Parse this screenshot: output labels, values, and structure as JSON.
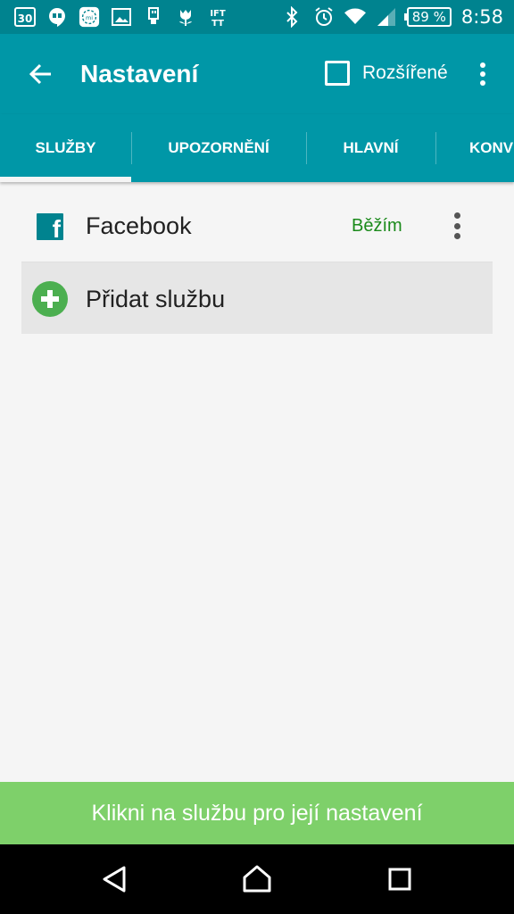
{
  "status_bar": {
    "notification_icons": [
      "calendar-30-icon",
      "hangouts-icon",
      "mi-fit-icon",
      "image-icon",
      "usb-icon",
      "tulip-icon",
      "ifttt-icon"
    ],
    "calendar_day": "30",
    "battery_level": "89 %",
    "time": "8:58"
  },
  "toolbar": {
    "title": "Nastavení",
    "extended_label": "Rozšířené",
    "extended_checked": false
  },
  "tabs": [
    {
      "label": "SLUŽBY",
      "selected": true
    },
    {
      "label": "UPOZORNĚNÍ",
      "selected": false
    },
    {
      "label": "HLAVNÍ",
      "selected": false
    },
    {
      "label": "KONV",
      "selected": false
    }
  ],
  "services": {
    "items": [
      {
        "name": "Facebook",
        "status": "Běžím",
        "icon": "facebook-icon"
      }
    ],
    "add_label": "Přidat službu"
  },
  "hint": "Klikni na službu pro její nastavení",
  "colors": {
    "status_bar": "#00838f",
    "toolbar": "#0097a7",
    "running": "#1b8a1b",
    "add": "#4caf50",
    "hint_bar": "#7ed06a"
  }
}
